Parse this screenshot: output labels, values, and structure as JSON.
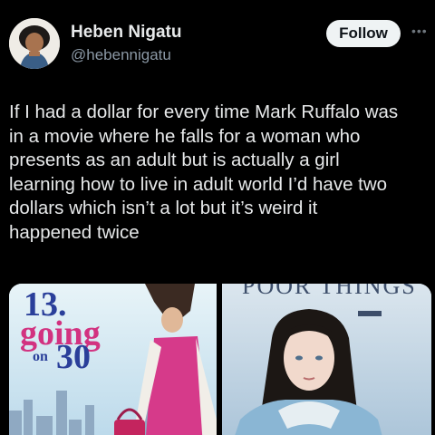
{
  "author": {
    "name": "Heben Nigatu",
    "handle": "@hebennigatu"
  },
  "actions": {
    "follow_label": "Follow",
    "more_icon": "more-dots-icon"
  },
  "tweet": {
    "text": "If I had a dollar for every time Mark Ruffalo was\nin a movie where he falls for a woman who\npresents as an adult but is actually a girl\nlearning how to live in adult world I’d have two\ndollars which isn’t a lot but it’s weird it\nhappened twice"
  },
  "media": {
    "left_poster": {
      "title_13": "13.",
      "title_going": "going",
      "title_on": "on",
      "title_30": "30"
    },
    "right_poster": {
      "title": "POOR THINGS"
    }
  },
  "colors": {
    "background": "#000000",
    "text": "#e7e9ea",
    "secondary_text": "#8b98a5",
    "follow_button_bg": "#eff3f4"
  }
}
